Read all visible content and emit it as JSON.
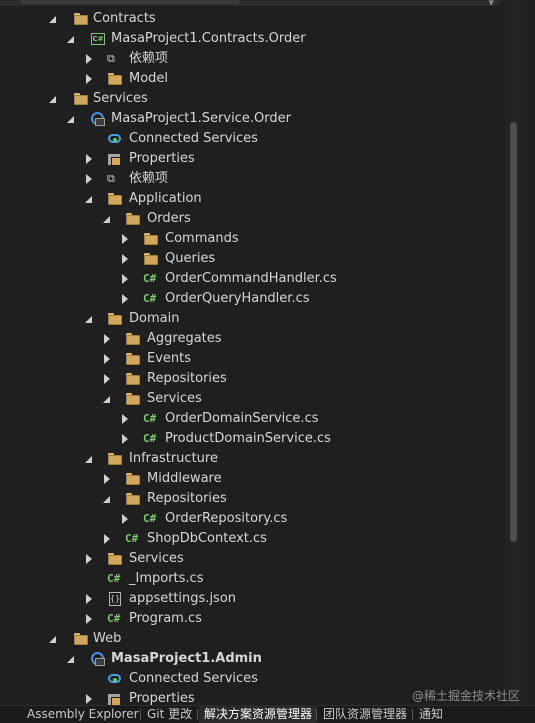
{
  "tree": [
    {
      "label": "Contracts",
      "icon": "folder-icon",
      "state": "expanded",
      "indent": 0,
      "bold": false
    },
    {
      "label": "MasaProject1.Contracts.Order",
      "icon": "csharp-project-icon",
      "state": "expanded",
      "indent": 1,
      "bold": false
    },
    {
      "label": "依赖项",
      "icon": "dependencies-icon",
      "state": "collapsed",
      "indent": 2,
      "bold": false
    },
    {
      "label": "Model",
      "icon": "folder-icon",
      "state": "collapsed",
      "indent": 2,
      "bold": false
    },
    {
      "label": "Services",
      "icon": "folder-icon",
      "state": "expanded",
      "indent": 0,
      "bold": false
    },
    {
      "label": "MasaProject1.Service.Order",
      "icon": "web-project-icon",
      "state": "expanded",
      "indent": 1,
      "bold": false
    },
    {
      "label": "Connected Services",
      "icon": "connected-services-icon",
      "state": "none",
      "indent": 2,
      "bold": false
    },
    {
      "label": "Properties",
      "icon": "properties-icon",
      "state": "collapsed",
      "indent": 2,
      "bold": false
    },
    {
      "label": "依赖项",
      "icon": "dependencies-icon",
      "state": "collapsed",
      "indent": 2,
      "bold": false
    },
    {
      "label": "Application",
      "icon": "folder-icon",
      "state": "expanded",
      "indent": 2,
      "bold": false
    },
    {
      "label": "Orders",
      "icon": "folder-icon",
      "state": "expanded",
      "indent": 3,
      "bold": false
    },
    {
      "label": "Commands",
      "icon": "folder-icon",
      "state": "collapsed",
      "indent": 4,
      "bold": false
    },
    {
      "label": "Queries",
      "icon": "folder-icon",
      "state": "collapsed",
      "indent": 4,
      "bold": false
    },
    {
      "label": "OrderCommandHandler.cs",
      "icon": "csharp-file-icon",
      "state": "collapsed",
      "indent": 4,
      "bold": false
    },
    {
      "label": "OrderQueryHandler.cs",
      "icon": "csharp-file-icon",
      "state": "collapsed",
      "indent": 4,
      "bold": false
    },
    {
      "label": "Domain",
      "icon": "folder-icon",
      "state": "expanded",
      "indent": 2,
      "bold": false
    },
    {
      "label": "Aggregates",
      "icon": "folder-icon",
      "state": "collapsed",
      "indent": 3,
      "bold": false
    },
    {
      "label": "Events",
      "icon": "folder-icon",
      "state": "collapsed",
      "indent": 3,
      "bold": false
    },
    {
      "label": "Repositories",
      "icon": "folder-icon",
      "state": "collapsed",
      "indent": 3,
      "bold": false
    },
    {
      "label": "Services",
      "icon": "folder-icon",
      "state": "expanded",
      "indent": 3,
      "bold": false
    },
    {
      "label": "OrderDomainService.cs",
      "icon": "csharp-file-icon",
      "state": "collapsed",
      "indent": 4,
      "bold": false
    },
    {
      "label": "ProductDomainService.cs",
      "icon": "csharp-file-icon",
      "state": "collapsed",
      "indent": 4,
      "bold": false
    },
    {
      "label": "Infrastructure",
      "icon": "folder-icon",
      "state": "expanded",
      "indent": 2,
      "bold": false
    },
    {
      "label": "Middleware",
      "icon": "folder-icon",
      "state": "collapsed",
      "indent": 3,
      "bold": false
    },
    {
      "label": "Repositories",
      "icon": "folder-icon",
      "state": "expanded",
      "indent": 3,
      "bold": false
    },
    {
      "label": "OrderRepository.cs",
      "icon": "csharp-file-icon",
      "state": "collapsed",
      "indent": 4,
      "bold": false
    },
    {
      "label": "ShopDbContext.cs",
      "icon": "csharp-file-icon",
      "state": "collapsed",
      "indent": 3,
      "bold": false
    },
    {
      "label": "Services",
      "icon": "folder-icon",
      "state": "collapsed",
      "indent": 2,
      "bold": false
    },
    {
      "label": "_Imports.cs",
      "icon": "csharp-file-icon",
      "state": "none",
      "indent": 2,
      "bold": false
    },
    {
      "label": "appsettings.json",
      "icon": "json-file-icon",
      "state": "collapsed",
      "indent": 2,
      "bold": false
    },
    {
      "label": "Program.cs",
      "icon": "csharp-file-icon",
      "state": "collapsed",
      "indent": 2,
      "bold": false
    },
    {
      "label": "Web",
      "icon": "folder-icon",
      "state": "expanded",
      "indent": 0,
      "bold": false
    },
    {
      "label": "MasaProject1.Admin",
      "icon": "web-project-icon",
      "state": "expanded",
      "indent": 1,
      "bold": true
    },
    {
      "label": "Connected Services",
      "icon": "connected-services-icon",
      "state": "none",
      "indent": 2,
      "bold": false
    },
    {
      "label": "Properties",
      "icon": "properties-icon",
      "state": "collapsed",
      "indent": 2,
      "bold": false
    }
  ],
  "tabs": [
    {
      "label": "Assembly Explorer",
      "active": false
    },
    {
      "label": "Git 更改",
      "active": false
    },
    {
      "label": "解决方案资源管理器",
      "active": true
    },
    {
      "label": "团队资源管理器",
      "active": false
    },
    {
      "label": "通知",
      "active": false
    }
  ],
  "watermark": "@稀土掘金技术社区"
}
